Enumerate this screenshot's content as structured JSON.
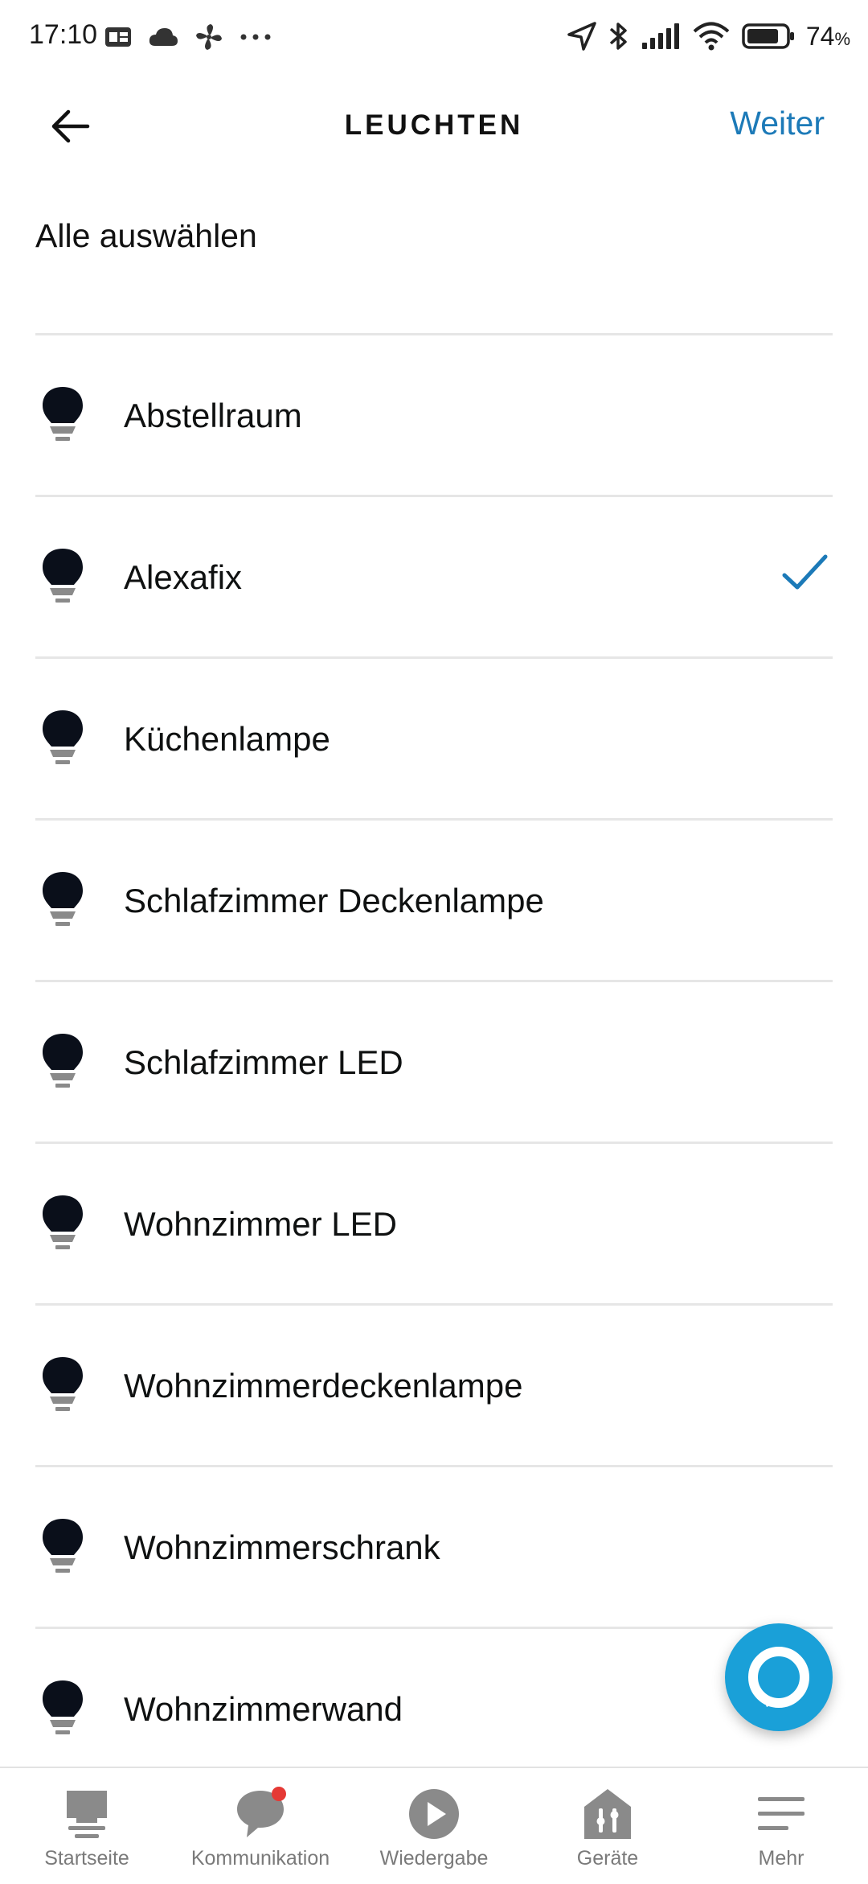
{
  "status_bar": {
    "time": "17:10",
    "battery": "74",
    "battery_unit": "%",
    "icons_left": [
      "sim-card-icon",
      "cloud-icon",
      "fan-icon",
      "more-dots-icon"
    ],
    "icons_right": [
      "location-icon",
      "bluetooth-icon",
      "signal-icon",
      "wifi-icon",
      "battery-icon"
    ]
  },
  "header": {
    "title": "LEUCHTEN",
    "next_label": "Weiter",
    "back_icon": "back-arrow-icon"
  },
  "select_all_label": "Alle auswählen",
  "devices": [
    {
      "name": "Abstellraum",
      "selected": false
    },
    {
      "name": "Alexafix",
      "selected": true
    },
    {
      "name": "Küchenlampe",
      "selected": false
    },
    {
      "name": "Schlafzimmer Deckenlampe",
      "selected": false
    },
    {
      "name": "Schlafzimmer LED",
      "selected": false
    },
    {
      "name": "Wohnzimmer LED",
      "selected": false
    },
    {
      "name": "Wohnzimmerdeckenlampe",
      "selected": false
    },
    {
      "name": "Wohnzimmerschrank",
      "selected": false
    },
    {
      "name": "Wohnzimmerwand",
      "selected": false
    }
  ],
  "bottom_nav": [
    {
      "label": "Startseite",
      "icon": "home-icon"
    },
    {
      "label": "Kommunikation",
      "icon": "chat-bubble-icon"
    },
    {
      "label": "Wiedergabe",
      "icon": "play-icon"
    },
    {
      "label": "Geräte",
      "icon": "devices-house-icon"
    },
    {
      "label": "Mehr",
      "icon": "menu-icon"
    }
  ],
  "colors": {
    "accent": "#1c7ab8",
    "fab": "#1aa0d8",
    "notification_dot": "#e53935",
    "bulb": "#0a0f1a",
    "bulb_base": "#8a8a8a",
    "nav_icon": "#8a8a8a"
  }
}
